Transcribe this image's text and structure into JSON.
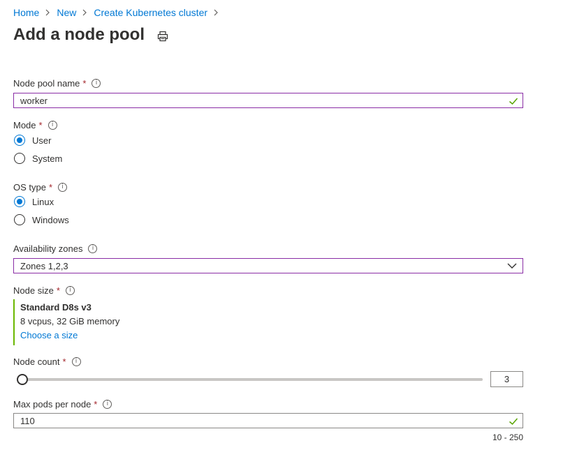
{
  "breadcrumb": [
    "Home",
    "New",
    "Create Kubernetes cluster"
  ],
  "page": {
    "title": "Add a node pool"
  },
  "node_pool_name": {
    "label": "Node pool name",
    "required": "*",
    "value": "worker"
  },
  "mode": {
    "label": "Mode",
    "required": "*",
    "options": [
      "User",
      "System"
    ],
    "selected": "User"
  },
  "os_type": {
    "label": "OS type",
    "required": "*",
    "options": [
      "Linux",
      "Windows"
    ],
    "selected": "Linux"
  },
  "availability_zones": {
    "label": "Availability zones",
    "value": "Zones 1,2,3"
  },
  "node_size": {
    "label": "Node size",
    "required": "*",
    "name": "Standard D8s v3",
    "description": "8 vcpus, 32 GiB memory",
    "link": "Choose a size"
  },
  "node_count": {
    "label": "Node count",
    "required": "*",
    "value": "3"
  },
  "max_pods": {
    "label": "Max pods per node",
    "required": "*",
    "value": "110",
    "range_hint": "10 - 250"
  },
  "icons": {
    "info": "info-icon",
    "valid": "checkmark-icon",
    "print": "print-icon",
    "dropdown": "chevron-down-icon",
    "breadcrumb_sep": "chevron-right-icon"
  },
  "colors": {
    "link": "#0078d4",
    "required": "#a4262c",
    "valid": "#57a300",
    "focus_border": "#8a2da5",
    "size_accent": "#6bb700"
  }
}
